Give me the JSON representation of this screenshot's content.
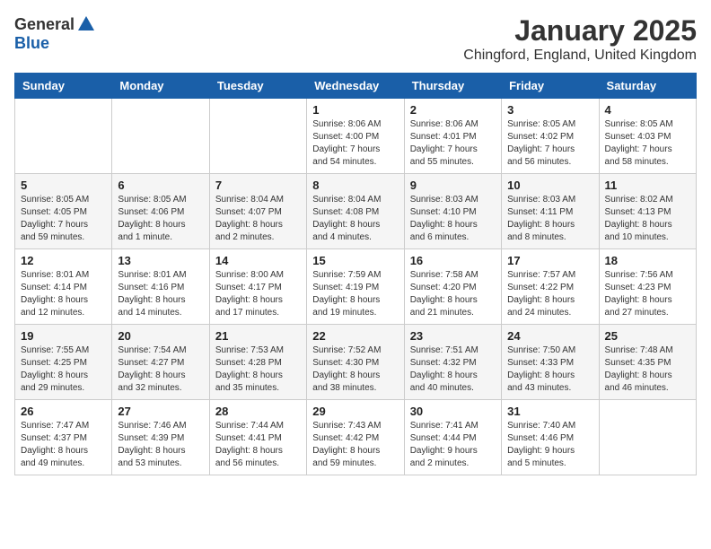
{
  "header": {
    "logo_general": "General",
    "logo_blue": "Blue",
    "month_title": "January 2025",
    "location": "Chingford, England, United Kingdom"
  },
  "weekdays": [
    "Sunday",
    "Monday",
    "Tuesday",
    "Wednesday",
    "Thursday",
    "Friday",
    "Saturday"
  ],
  "weeks": [
    [
      {
        "day": "",
        "info": ""
      },
      {
        "day": "",
        "info": ""
      },
      {
        "day": "",
        "info": ""
      },
      {
        "day": "1",
        "info": "Sunrise: 8:06 AM\nSunset: 4:00 PM\nDaylight: 7 hours\nand 54 minutes."
      },
      {
        "day": "2",
        "info": "Sunrise: 8:06 AM\nSunset: 4:01 PM\nDaylight: 7 hours\nand 55 minutes."
      },
      {
        "day": "3",
        "info": "Sunrise: 8:05 AM\nSunset: 4:02 PM\nDaylight: 7 hours\nand 56 minutes."
      },
      {
        "day": "4",
        "info": "Sunrise: 8:05 AM\nSunset: 4:03 PM\nDaylight: 7 hours\nand 58 minutes."
      }
    ],
    [
      {
        "day": "5",
        "info": "Sunrise: 8:05 AM\nSunset: 4:05 PM\nDaylight: 7 hours\nand 59 minutes."
      },
      {
        "day": "6",
        "info": "Sunrise: 8:05 AM\nSunset: 4:06 PM\nDaylight: 8 hours\nand 1 minute."
      },
      {
        "day": "7",
        "info": "Sunrise: 8:04 AM\nSunset: 4:07 PM\nDaylight: 8 hours\nand 2 minutes."
      },
      {
        "day": "8",
        "info": "Sunrise: 8:04 AM\nSunset: 4:08 PM\nDaylight: 8 hours\nand 4 minutes."
      },
      {
        "day": "9",
        "info": "Sunrise: 8:03 AM\nSunset: 4:10 PM\nDaylight: 8 hours\nand 6 minutes."
      },
      {
        "day": "10",
        "info": "Sunrise: 8:03 AM\nSunset: 4:11 PM\nDaylight: 8 hours\nand 8 minutes."
      },
      {
        "day": "11",
        "info": "Sunrise: 8:02 AM\nSunset: 4:13 PM\nDaylight: 8 hours\nand 10 minutes."
      }
    ],
    [
      {
        "day": "12",
        "info": "Sunrise: 8:01 AM\nSunset: 4:14 PM\nDaylight: 8 hours\nand 12 minutes."
      },
      {
        "day": "13",
        "info": "Sunrise: 8:01 AM\nSunset: 4:16 PM\nDaylight: 8 hours\nand 14 minutes."
      },
      {
        "day": "14",
        "info": "Sunrise: 8:00 AM\nSunset: 4:17 PM\nDaylight: 8 hours\nand 17 minutes."
      },
      {
        "day": "15",
        "info": "Sunrise: 7:59 AM\nSunset: 4:19 PM\nDaylight: 8 hours\nand 19 minutes."
      },
      {
        "day": "16",
        "info": "Sunrise: 7:58 AM\nSunset: 4:20 PM\nDaylight: 8 hours\nand 21 minutes."
      },
      {
        "day": "17",
        "info": "Sunrise: 7:57 AM\nSunset: 4:22 PM\nDaylight: 8 hours\nand 24 minutes."
      },
      {
        "day": "18",
        "info": "Sunrise: 7:56 AM\nSunset: 4:23 PM\nDaylight: 8 hours\nand 27 minutes."
      }
    ],
    [
      {
        "day": "19",
        "info": "Sunrise: 7:55 AM\nSunset: 4:25 PM\nDaylight: 8 hours\nand 29 minutes."
      },
      {
        "day": "20",
        "info": "Sunrise: 7:54 AM\nSunset: 4:27 PM\nDaylight: 8 hours\nand 32 minutes."
      },
      {
        "day": "21",
        "info": "Sunrise: 7:53 AM\nSunset: 4:28 PM\nDaylight: 8 hours\nand 35 minutes."
      },
      {
        "day": "22",
        "info": "Sunrise: 7:52 AM\nSunset: 4:30 PM\nDaylight: 8 hours\nand 38 minutes."
      },
      {
        "day": "23",
        "info": "Sunrise: 7:51 AM\nSunset: 4:32 PM\nDaylight: 8 hours\nand 40 minutes."
      },
      {
        "day": "24",
        "info": "Sunrise: 7:50 AM\nSunset: 4:33 PM\nDaylight: 8 hours\nand 43 minutes."
      },
      {
        "day": "25",
        "info": "Sunrise: 7:48 AM\nSunset: 4:35 PM\nDaylight: 8 hours\nand 46 minutes."
      }
    ],
    [
      {
        "day": "26",
        "info": "Sunrise: 7:47 AM\nSunset: 4:37 PM\nDaylight: 8 hours\nand 49 minutes."
      },
      {
        "day": "27",
        "info": "Sunrise: 7:46 AM\nSunset: 4:39 PM\nDaylight: 8 hours\nand 53 minutes."
      },
      {
        "day": "28",
        "info": "Sunrise: 7:44 AM\nSunset: 4:41 PM\nDaylight: 8 hours\nand 56 minutes."
      },
      {
        "day": "29",
        "info": "Sunrise: 7:43 AM\nSunset: 4:42 PM\nDaylight: 8 hours\nand 59 minutes."
      },
      {
        "day": "30",
        "info": "Sunrise: 7:41 AM\nSunset: 4:44 PM\nDaylight: 9 hours\nand 2 minutes."
      },
      {
        "day": "31",
        "info": "Sunrise: 7:40 AM\nSunset: 4:46 PM\nDaylight: 9 hours\nand 5 minutes."
      },
      {
        "day": "",
        "info": ""
      }
    ]
  ]
}
